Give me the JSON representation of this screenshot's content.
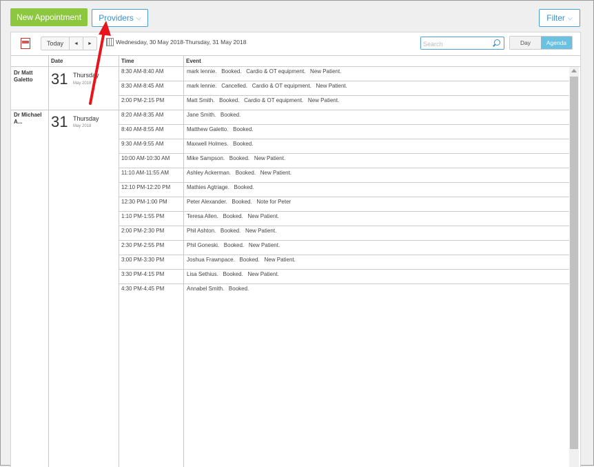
{
  "header": {
    "new_appointment": "New Appointment",
    "providers": "Providers",
    "filter": "Filter"
  },
  "toolbar": {
    "today": "Today",
    "prev": "◄",
    "next": "►",
    "date_range": "Wednesday, 30 May 2018-Thursday, 31 May 2018",
    "search_placeholder": "Search",
    "view_day": "Day",
    "view_agenda": "Agenda"
  },
  "columns": {
    "date": "Date",
    "time": "Time",
    "event": "Event"
  },
  "groups": [
    {
      "provider": "Dr Matt Galetto",
      "day_number": "31",
      "weekday": "Thursday",
      "month": "May 2018",
      "rows": [
        {
          "time": "8:30 AM-8:40 AM",
          "event": "mark lennie.   Booked.   Cardio & OT equipment.   New Patient."
        },
        {
          "time": "8:30 AM-8:45 AM",
          "event": "mark lennie.   Cancelled.   Cardio & OT equipment.   New Patient."
        },
        {
          "time": "2:00 PM-2:15 PM",
          "event": "Matt Smith.   Booked.   Cardio & OT equipment.   New Patient."
        }
      ]
    },
    {
      "provider": "Dr Michael A...",
      "day_number": "31",
      "weekday": "Thursday",
      "month": "May 2018",
      "rows": [
        {
          "time": "8:20 AM-8:35 AM",
          "event": "Jane Smith.   Booked."
        },
        {
          "time": "8:40 AM-8:55 AM",
          "event": "Matthew Galetto.   Booked."
        },
        {
          "time": "9:30 AM-9:55 AM",
          "event": "Maxwell Holmes.   Booked."
        },
        {
          "time": "10:00 AM-10:30 AM",
          "event": "Mike Sampson.   Booked.   New Patient."
        },
        {
          "time": "11:10 AM-11:55 AM",
          "event": "Ashley Ackerman.   Booked.   New Patient."
        },
        {
          "time": "12:10 PM-12:20 PM",
          "event": "Mathies Agtriage.   Booked."
        },
        {
          "time": "12:30 PM-1:00 PM",
          "event": "Peter Alexander.   Booked.   Note for Peter"
        },
        {
          "time": "1:10 PM-1:55 PM",
          "event": "Teresa Allen.   Booked.   New Patient."
        },
        {
          "time": "2:00 PM-2:30 PM",
          "event": "Phil Ashton.   Booked.   New Patient."
        },
        {
          "time": "2:30 PM-2:55 PM",
          "event": "Phil Goneski.   Booked.   New Patient."
        },
        {
          "time": "3:00 PM-3:30 PM",
          "event": "Joshua Frawnpace.   Booked.   New Patient."
        },
        {
          "time": "3:30 PM-4:15 PM",
          "event": "Lisa Sethius.   Booked.   New Patient."
        },
        {
          "time": "4:30 PM-4:45 PM",
          "event": "Annabel Smith.   Booked."
        }
      ]
    }
  ],
  "colors": {
    "accent_green": "#8dc63f",
    "accent_blue": "#4a9fd5",
    "agenda_active": "#6cc0e0",
    "annotation_arrow": "#e8141c"
  },
  "icons": {
    "pdf": "pdf-icon",
    "calendar": "calendar-icon",
    "search": "search-icon",
    "chevron": "chevron-down-icon"
  }
}
